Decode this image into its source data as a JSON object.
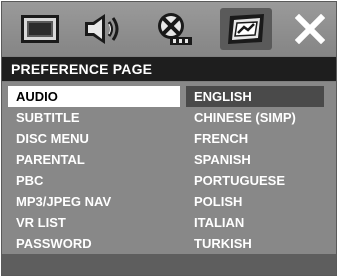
{
  "icons": [
    {
      "name": "general-setup-icon"
    },
    {
      "name": "audio-setup-icon"
    },
    {
      "name": "video-setup-icon"
    },
    {
      "name": "preference-setup-icon"
    },
    {
      "name": "exit-icon"
    }
  ],
  "page_title": "PREFERENCE PAGE",
  "menu": [
    {
      "label": "AUDIO",
      "selected": true
    },
    {
      "label": "SUBTITLE"
    },
    {
      "label": "DISC MENU"
    },
    {
      "label": "PARENTAL"
    },
    {
      "label": "PBC"
    },
    {
      "label": "MP3/JPEG NAV"
    },
    {
      "label": "VR LIST"
    },
    {
      "label": "PASSWORD"
    }
  ],
  "options": [
    {
      "label": "ENGLISH",
      "highlighted": true
    },
    {
      "label": "CHINESE (SIMP)"
    },
    {
      "label": "FRENCH"
    },
    {
      "label": "SPANISH"
    },
    {
      "label": "PORTUGUESE"
    },
    {
      "label": "POLISH"
    },
    {
      "label": "ITALIAN"
    },
    {
      "label": "TURKISH"
    }
  ]
}
